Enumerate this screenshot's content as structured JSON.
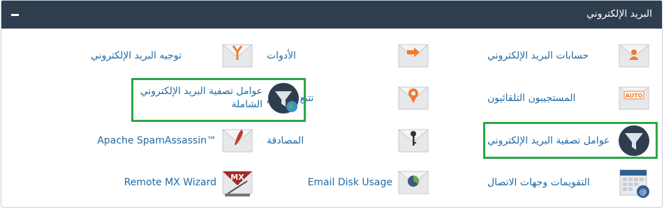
{
  "panel": {
    "title": "البريد الإلكتروني",
    "collapse_symbol": "−"
  },
  "items": [
    {
      "label": "حسابات البريد الإلكتروني",
      "icon": "envelope-person-icon",
      "accent": "#f07b2c"
    },
    {
      "label": "الأدوات",
      "icon": "envelope-arrow-icon",
      "accent": "#f07b2c"
    },
    {
      "label": "توجيه البريد الإلكتروني",
      "icon": "envelope-fork-icon",
      "accent": "#f07b2c"
    },
    {
      "label": "المستجيبون التلقائيون",
      "icon": "envelope-auto-icon",
      "accent": "#f07b2c",
      "badge": "AUTO"
    },
    {
      "label": "تتبع التسليم",
      "icon": "envelope-pin-icon",
      "accent": "#f07b2c"
    },
    {
      "label": "عوامل تصفية البريد الإلكتروني الشاملة",
      "icon": "global-filter-icon",
      "accent": "#2f3e4f"
    },
    {
      "label": "عوامل تصفية البريد الإلكتروني",
      "icon": "filter-icon",
      "accent": "#2f3e4f"
    },
    {
      "label": "المصادقة",
      "icon": "envelope-key-icon",
      "accent": "#333333"
    },
    {
      "label": "Apache SpamAssassin™",
      "icon": "envelope-quill-icon",
      "accent": "#c0392b"
    },
    {
      "label": "التقويمات وجهات الاتصال",
      "icon": "calendar-at-icon",
      "accent": "#2f5f8f"
    },
    {
      "label": "Email Disk Usage",
      "icon": "envelope-pie-icon",
      "accent": "#6aa84f"
    },
    {
      "label": "Remote MX Wizard",
      "icon": "mx-wizard-icon",
      "accent": "#a52a2a",
      "badge": "MX"
    }
  ],
  "colors": {
    "header_bg": "#2f3e4f",
    "link": "#1f6aa5",
    "highlight": "#2aa746",
    "icon_accent": "#f07b2c"
  }
}
